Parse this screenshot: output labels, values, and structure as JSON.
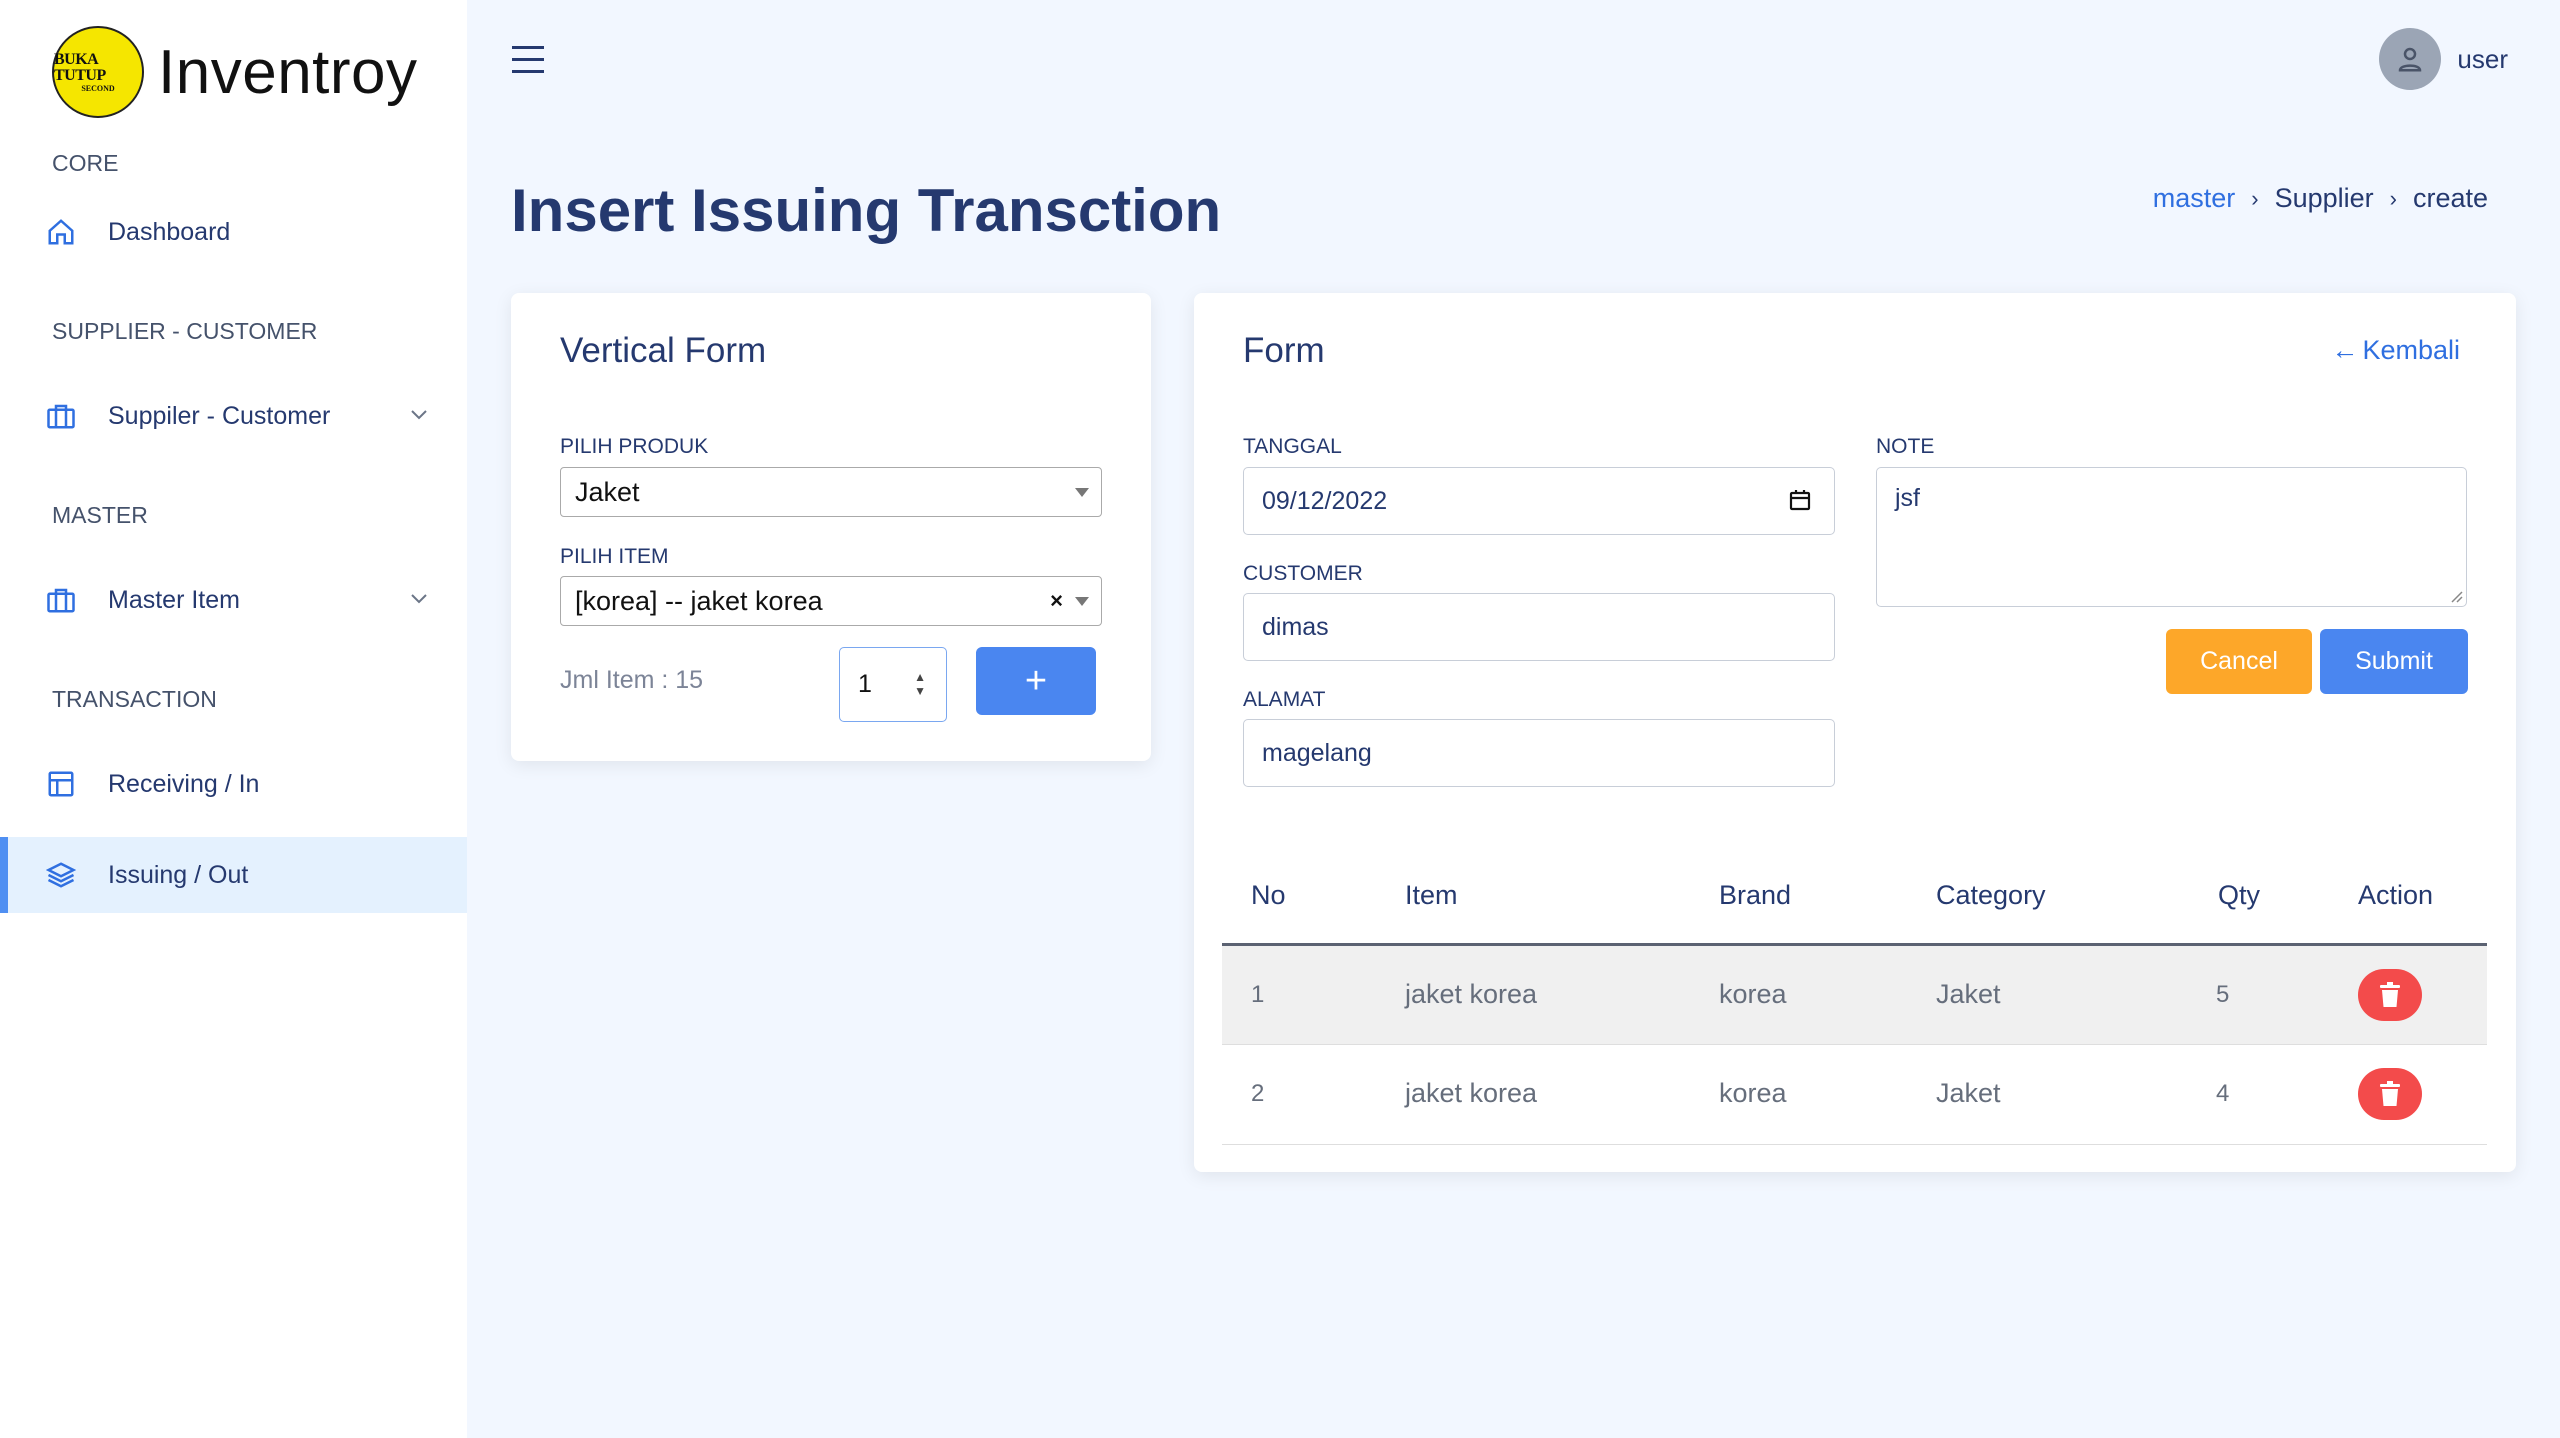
{
  "sidebar": {
    "brand_name": "Inventroy",
    "logo_text_1": "BUKA TUTUP",
    "logo_text_2": "SECOND",
    "sections": {
      "core": "CORE",
      "supplier_customer": "SUPPLIER - CUSTOMER",
      "master": "MASTER",
      "transaction": "TRANSACTION"
    },
    "items": {
      "dashboard": "Dashboard",
      "suppiler_customer": "Suppiler - Customer",
      "master_item": "Master Item",
      "receiving": "Receiving / In",
      "issuing": "Issuing / Out"
    }
  },
  "header": {
    "user_name": "user"
  },
  "page": {
    "title": "Insert Issuing Transction",
    "breadcrumb": [
      "master",
      "Supplier",
      "create"
    ]
  },
  "left_form": {
    "title": "Vertical Form",
    "produk_label": "PILIH PRODUK",
    "produk_value": "Jaket",
    "item_label": "PILIH ITEM",
    "item_value": "[korea] -- jaket korea",
    "jml_item": "Jml Item : 15",
    "qty_value": "1",
    "add_button": "+"
  },
  "right_form": {
    "title": "Form",
    "back_link": "Kembali",
    "tanggal_label": "TANGGAL",
    "tanggal_value": "09/12/2022",
    "customer_label": "CUSTOMER",
    "customer_value": "dimas",
    "alamat_label": "ALAMAT",
    "alamat_value": "magelang",
    "note_label": "NOTE",
    "note_value": "jsf",
    "cancel_button": "Cancel",
    "submit_button": "Submit"
  },
  "table": {
    "headers": [
      "No",
      "Item",
      "Brand",
      "Category",
      "Qty",
      "Action"
    ],
    "rows": [
      {
        "no": "1",
        "item": "jaket korea",
        "brand": "korea",
        "category": "Jaket",
        "qty": "5"
      },
      {
        "no": "2",
        "item": "jaket korea",
        "brand": "korea",
        "category": "Jaket",
        "qty": "4"
      }
    ]
  },
  "colors": {
    "primary": "#4a86f0",
    "warning": "#fda729",
    "danger": "#f34b4b",
    "text": "#25396f",
    "background": "#f2f7ff"
  }
}
